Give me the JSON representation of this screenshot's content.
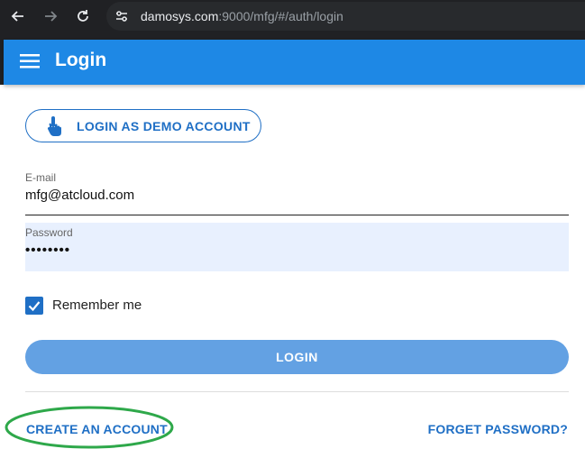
{
  "browser": {
    "url_host": "damosys.com",
    "url_path": ":9000/mfg/#/auth/login",
    "icons": [
      "back-arrow-icon",
      "forward-arrow-icon",
      "reload-icon",
      "site-info-icon"
    ]
  },
  "app_bar": {
    "title": "Login",
    "menu_icon": "hamburger-menu-icon",
    "color": "#1e88e5"
  },
  "demo_button": {
    "label": "LOGIN AS DEMO ACCOUNT",
    "icon": "pointing-hand-icon"
  },
  "form": {
    "email": {
      "label": "E-mail",
      "value": "mfg@atcloud.com"
    },
    "password": {
      "label": "Password",
      "value": "••••••••"
    },
    "remember": {
      "label": "Remember me",
      "checked": true
    },
    "login_label": "LOGIN"
  },
  "links": {
    "create_account": "CREATE AN ACCOUNT",
    "forget_password": "FORGET PASSWORD?"
  },
  "colors": {
    "accent": "#1f6fc5",
    "login_button": "#63a1e3",
    "password_bg": "#e8f0fe",
    "highlight_ellipse": "#2ea84a"
  }
}
